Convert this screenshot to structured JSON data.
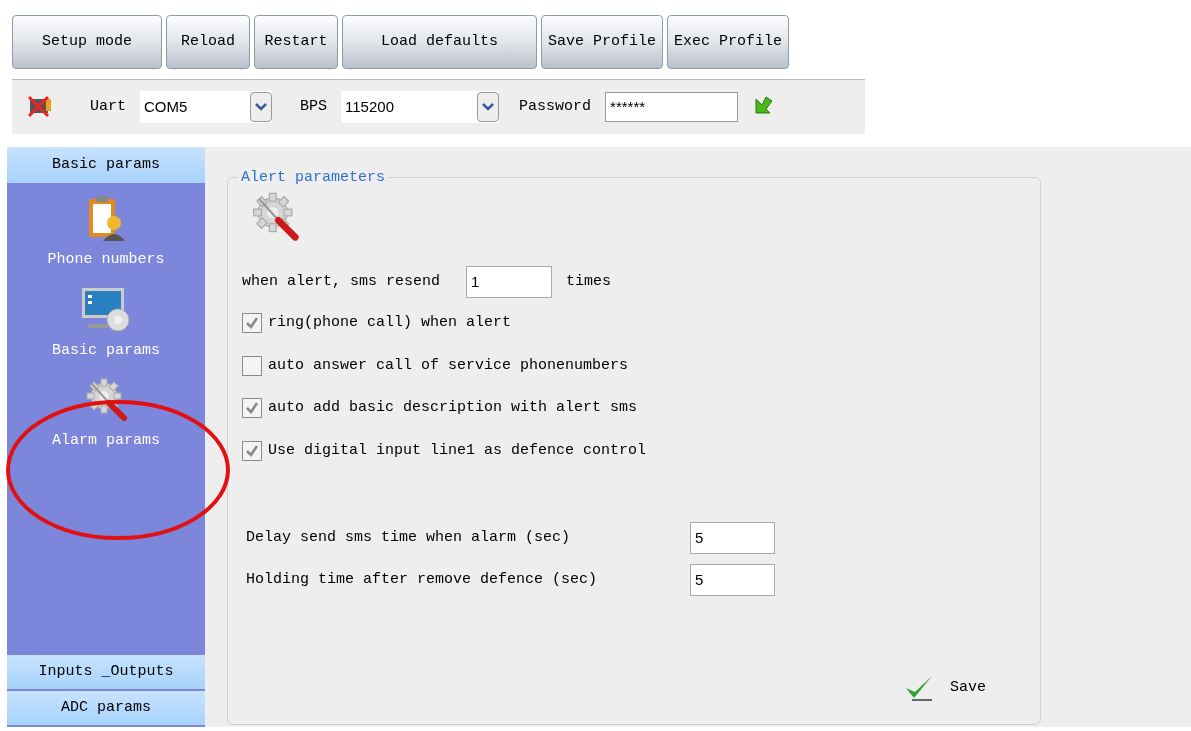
{
  "toolbar": {
    "buttons": [
      "Setup mode",
      "Reload",
      "Restart",
      "Load defaults",
      "Save Profile",
      "Exec Profile"
    ]
  },
  "connection": {
    "uart_label": "Uart",
    "uart_value": "COM5",
    "bps_label": "BPS",
    "bps_value": "115200",
    "password_label": "Password",
    "password_value": "******"
  },
  "sidebar": {
    "header": "Basic params",
    "items": [
      {
        "label": "Phone numbers",
        "highlighted": false
      },
      {
        "label": "Basic params",
        "highlighted": false
      },
      {
        "label": "Alarm params",
        "highlighted": true
      }
    ],
    "footer_sections": [
      "Inputs _Outputs",
      "ADC params"
    ]
  },
  "panel": {
    "title": "Alert parameters",
    "resend": {
      "label": "when alert, sms resend",
      "value": "1",
      "suffix": "times"
    },
    "options": [
      {
        "label": "ring(phone call) when alert",
        "checked": true
      },
      {
        "label": "auto answer call of service phonenumbers",
        "checked": false
      },
      {
        "label": "auto add basic description with alert sms",
        "checked": true
      },
      {
        "label": "Use digital input line1 as defence control",
        "checked": true
      }
    ],
    "fields": [
      {
        "label": "Delay send sms time when alarm (sec)",
        "value": "5"
      },
      {
        "label": "Holding time after remove defence (sec)",
        "value": "5"
      }
    ],
    "save": "Save"
  }
}
